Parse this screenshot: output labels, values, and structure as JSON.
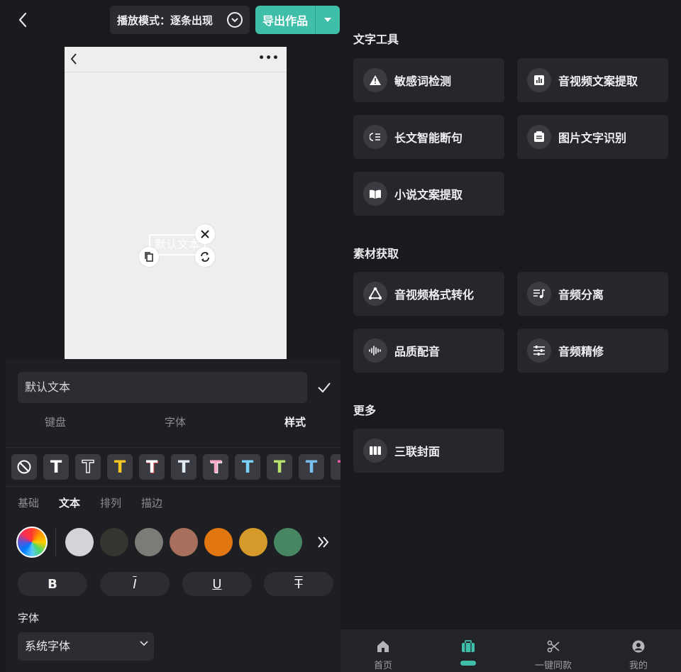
{
  "editor": {
    "play_mode_label": "播放模式：逐条出现",
    "export_label": "导出作品",
    "canvas_text": "默认文本",
    "input_value": "默认文本",
    "tabs": [
      "键盘",
      "字体",
      "样式"
    ],
    "active_tab": "样式",
    "style_presets": [
      {
        "name": "none",
        "color": "#ffffff"
      },
      {
        "name": "white",
        "color": "#ffffff"
      },
      {
        "name": "outline-white",
        "color": "#ffffff"
      },
      {
        "name": "yellow",
        "color": "#f3c623"
      },
      {
        "name": "white-red",
        "color": "#ffffff"
      },
      {
        "name": "white-blue",
        "color": "#dfe9f2"
      },
      {
        "name": "pink",
        "color": "#f7a8c8"
      },
      {
        "name": "cyan",
        "color": "#7ad3ff"
      },
      {
        "name": "lime",
        "color": "#b9e36b"
      },
      {
        "name": "blue",
        "color": "#79c0f0"
      },
      {
        "name": "magenta",
        "color": "#f05aa5"
      }
    ],
    "subtabs": [
      "基础",
      "文本",
      "排列",
      "描边"
    ],
    "active_subtab": "文本",
    "swatches": [
      "#d4d4d8",
      "#36342f",
      "#7b7c77",
      "#a8705c",
      "#e2760f",
      "#d59a2a",
      "#468663"
    ],
    "format_buttons": [
      "B",
      "I",
      "U",
      "T"
    ],
    "font_label": "字体",
    "font_value": "系统字体"
  },
  "tools": {
    "sections": [
      {
        "title": "文字工具",
        "items": [
          {
            "label": "敏感词检测",
            "icon": "warning-icon"
          },
          {
            "label": "音视频文案提取",
            "icon": "chart-icon"
          },
          {
            "label": "长文智能断句",
            "icon": "sentence-icon"
          },
          {
            "label": "图片文字识别",
            "icon": "ocr-icon"
          },
          {
            "label": "小说文案提取",
            "icon": "book-icon"
          }
        ]
      },
      {
        "title": "素材获取",
        "items": [
          {
            "label": "音视频格式转化",
            "icon": "convert-icon"
          },
          {
            "label": "音频分离",
            "icon": "music-list-icon"
          },
          {
            "label": "品质配音",
            "icon": "waveform-icon"
          },
          {
            "label": "音频精修",
            "icon": "equalizer-icon"
          }
        ]
      },
      {
        "title": "更多",
        "items": [
          {
            "label": "三联封面",
            "icon": "triptych-icon"
          }
        ]
      }
    ]
  },
  "nav": {
    "items": [
      {
        "label": "首页",
        "icon": "home-icon"
      },
      {
        "label": "",
        "icon": "toolbox-icon"
      },
      {
        "label": "一键同款",
        "icon": "scissors-icon"
      },
      {
        "label": "我的",
        "icon": "profile-icon"
      }
    ],
    "active_index": 1,
    "accent": "#3fbfaa"
  }
}
